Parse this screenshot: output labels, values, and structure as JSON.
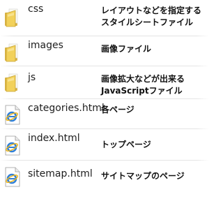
{
  "items": [
    {
      "name": "css",
      "desc": [
        "レイアウトなどを指定する",
        "スタイルシートファイル"
      ],
      "icon": "folder-icon"
    },
    {
      "name": "images",
      "desc": [
        "画像ファイル"
      ],
      "icon": "folder-icon"
    },
    {
      "name": "js",
      "desc": [
        "画像拡大などが出来る",
        "JavaScriptファイル"
      ],
      "icon": "folder-icon"
    },
    {
      "name": "categories.html",
      "desc": [
        "各ページ"
      ],
      "icon": "html-file-icon"
    },
    {
      "name": "index.html",
      "desc": [
        "トップページ"
      ],
      "icon": "html-file-icon"
    },
    {
      "name": "sitemap.html",
      "desc": [
        "サイトマップのページ"
      ],
      "icon": "html-file-icon"
    }
  ],
  "colors": {
    "folder": "#f2d15a",
    "folder_dark": "#c7a233",
    "ie_blue": "#2f7fd8",
    "ie_ring": "#f0b61a"
  }
}
